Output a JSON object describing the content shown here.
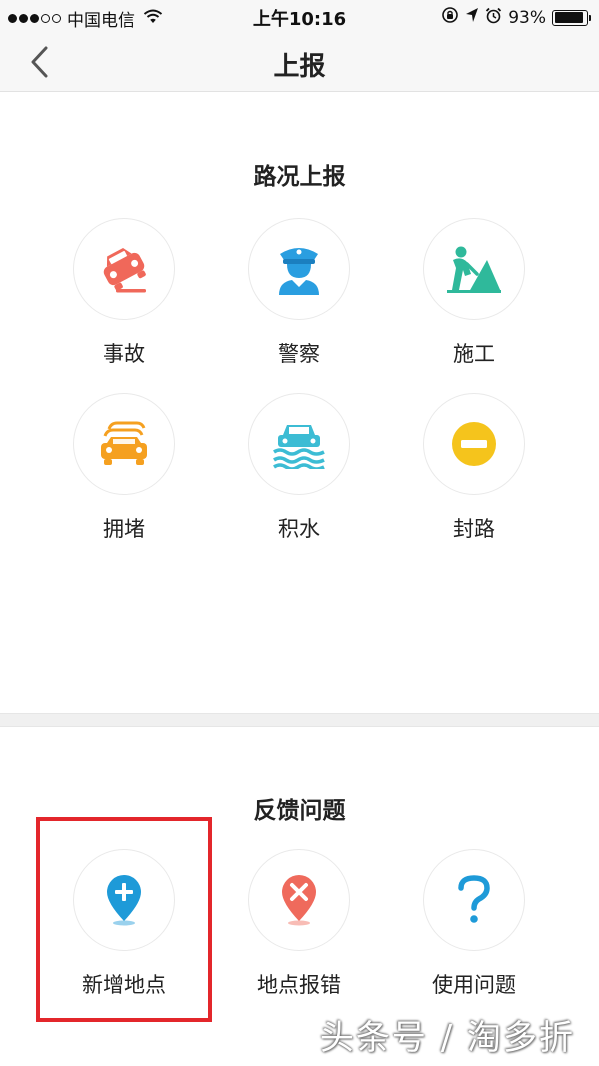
{
  "status_bar": {
    "carrier": "中国电信",
    "time": "上午10:16",
    "battery_percent": "93%",
    "battery_level": 0.93
  },
  "nav": {
    "title": "上报",
    "back_icon": "chevron-left-icon"
  },
  "road_report": {
    "title": "路况上报",
    "items": [
      {
        "label": "事故",
        "icon": "accident-car-icon",
        "color": "#f0685a"
      },
      {
        "label": "警察",
        "icon": "police-icon",
        "color": "#2a9ee0"
      },
      {
        "label": "施工",
        "icon": "construction-icon",
        "color": "#2fb99b"
      },
      {
        "label": "拥堵",
        "icon": "traffic-jam-icon",
        "color": "#f5a020"
      },
      {
        "label": "积水",
        "icon": "flood-icon",
        "color": "#3cbcd4"
      },
      {
        "label": "封路",
        "icon": "road-closed-icon",
        "color": "#f5c41c"
      }
    ]
  },
  "feedback": {
    "title": "反馈问题",
    "items": [
      {
        "label": "新增地点",
        "icon": "add-location-icon",
        "color": "#1e9ad8"
      },
      {
        "label": "地点报错",
        "icon": "location-error-icon",
        "color": "#ef6a5c"
      },
      {
        "label": "使用问题",
        "icon": "question-icon",
        "color": "#1e9ad8"
      }
    ]
  },
  "highlight_color": "#e3262b",
  "watermark": "头条号 / 淘多折"
}
